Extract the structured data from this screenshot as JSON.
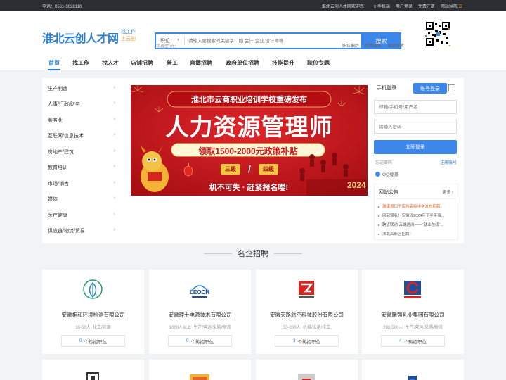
{
  "topbar": {
    "phone": "电话：0561-3028110",
    "welcome": "淮北云创人才网欢迎您！",
    "mobile": "手机端",
    "user_login": "用户登录",
    "free_register": "免费注册",
    "site_nav": "网站导航"
  },
  "logo": {
    "text": "淮北云创人才网",
    "slogan1": "找工作",
    "slogan2": "上云创"
  },
  "search": {
    "type": "职位",
    "placeholder": "请输入要搜索的关键字，如 会计,企业,设计师等",
    "button": "搜索",
    "hot_label": "热搜职位：",
    "links": [
      "职位偏历",
      "地图搜索",
      "高级搜索"
    ]
  },
  "nav": {
    "items": [
      "首页",
      "找工作",
      "找人才",
      "店铺招聘",
      "普工",
      "直播招聘",
      "政府单位招聘",
      "技能提升",
      "职位专题"
    ],
    "active": 0
  },
  "categories": [
    "生产制造",
    "人事/行政/财务",
    "服务业",
    "互联网/信息技术",
    "房地产/建筑",
    "教育培训",
    "市场/销售",
    "媒体",
    "医疗健康",
    "供应链/物流/贸易"
  ],
  "banner": {
    "headline": "淮北市云商职业培训学校重磅发布",
    "title": "人力资源管理师",
    "subtitle": "领取1500-2000元政策补贴",
    "level1": "三级",
    "slash": "/",
    "level2": "四级",
    "cta": "机不可失 · 赶紧报名喽!"
  },
  "login": {
    "tab_mobile": "手机登录",
    "tab_account": "账号登录",
    "username_placeholder": "邮箱/手机号/用户名",
    "password_placeholder": "请输入密码",
    "button": "立即登录",
    "forgot": "忘记密码",
    "register": "注册账号",
    "qq": "QQ登录"
  },
  "announcements": {
    "title": "网站公告",
    "more": "更多",
    "items": [
      "濉溪县口子实验高级中学发布招聘...",
      "网起报名！安徽省2024年下半年事...",
      "跨省联动 云端送岗——\"就业在线\"...",
      "淮北高新区招聘！"
    ]
  },
  "section": {
    "title": "名企招聘"
  },
  "companies": [
    {
      "name": "安徽相和环境检测有限公司",
      "size": "10-50人",
      "industry": "化工/能源",
      "jobs": "9",
      "jobs_label": "个热招职位"
    },
    {
      "name": "安徽理士电源技术有限公司",
      "size": "1000人以上",
      "industry": "生产/营运/采购/物流",
      "jobs": "9",
      "jobs_label": "个热招职位"
    },
    {
      "name": "安徽天路航空科技股份有限公司",
      "size": "50-200人",
      "industry": "机械/设备/技工",
      "jobs": "3",
      "jobs_label": "个热招职位"
    },
    {
      "name": "安徽曦强乳业集团有限公司",
      "size": "200-500人",
      "industry": "生产/营运/采购/物流",
      "jobs": "4",
      "jobs_label": "个热招职位"
    }
  ],
  "colors": {
    "brand": "#2a7fd4",
    "button": "#3d86ea",
    "banner_red": "#c8171c",
    "gold": "#f7d77a"
  }
}
